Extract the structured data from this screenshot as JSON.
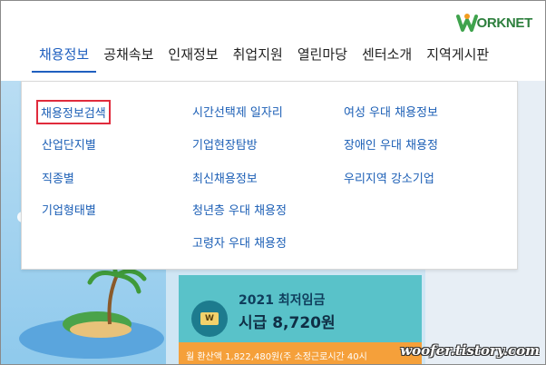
{
  "header": {
    "logo_text": "ORKNET",
    "logo_icon": "worknet-w-logo-icon"
  },
  "gnb": {
    "items": [
      {
        "label": "채용정보"
      },
      {
        "label": "공채속보"
      },
      {
        "label": "인재정보"
      },
      {
        "label": "취업지원"
      },
      {
        "label": "열린마당"
      },
      {
        "label": "센터소개"
      },
      {
        "label": "지역게시판"
      }
    ]
  },
  "dropdown": {
    "col1": [
      "채용정보검색",
      "산업단지별",
      "직종별",
      "기업형태별"
    ],
    "col2": [
      "시간선택제 일자리",
      "기업현장탐방",
      "최신채용정보",
      "청년층 우대 채용정",
      "고령자 우대 채용정"
    ],
    "col3": [
      "여성 우대 채용정보",
      "장애인 우대 채용정",
      "우리지역 강소기업"
    ]
  },
  "wage_banner": {
    "year_label": "2021 최저임금",
    "value": "시급 8,720원",
    "icon_text": "W",
    "strip_text": "월 환산액 1,822,480원(주 소정근로시간 40시"
  },
  "watermark": "woofer.tistory.com",
  "colors": {
    "accent_blue": "#1f5fbf",
    "link_blue": "#1c5fb6",
    "highlight_red": "#e02b3c",
    "banner_teal": "#59c2c9",
    "banner_orange": "#f5a03a"
  }
}
